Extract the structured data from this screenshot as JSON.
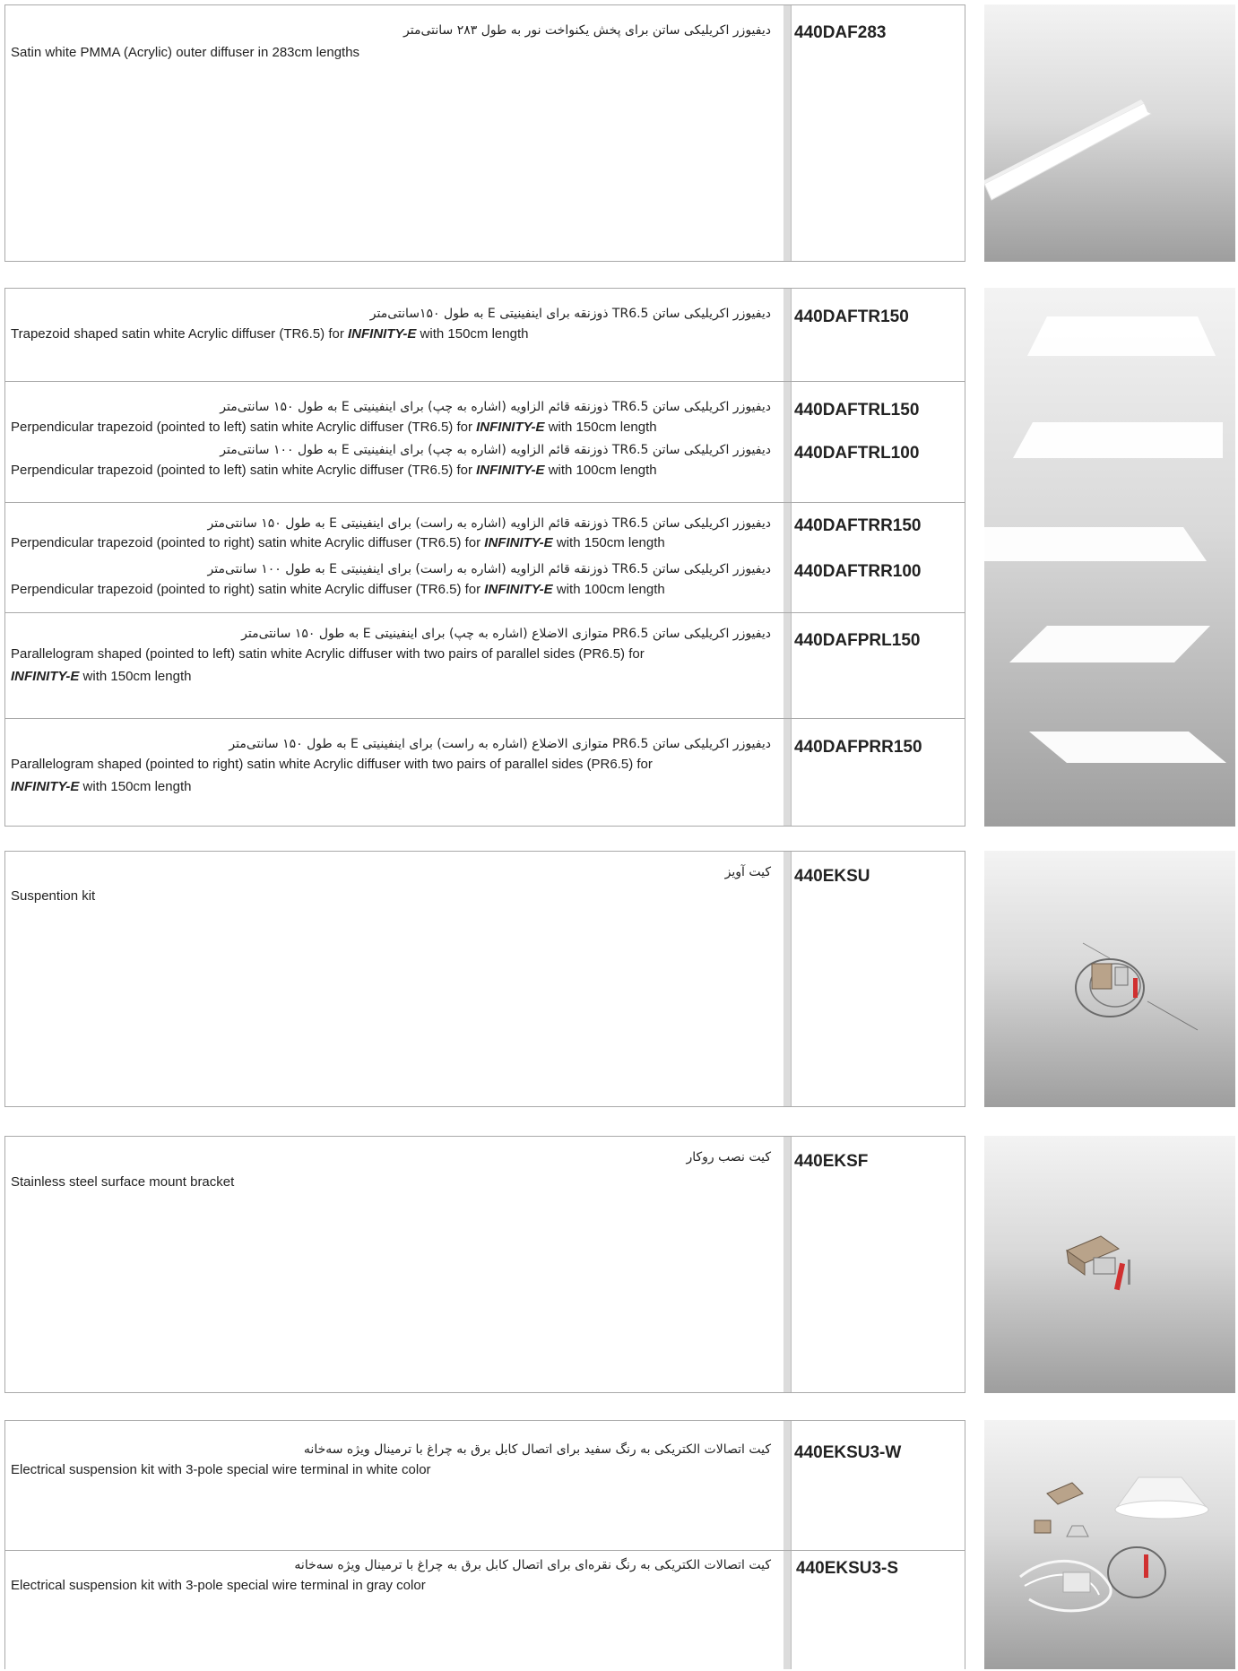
{
  "sections": [
    {
      "rows": [
        {
          "code": "440DAF283",
          "fa": "دیفیوزر اکریلیکی ساتن برای پخش یکنواخت نور به طول ۲۸۳ سانتی‌متر",
          "en": "Satin white PMMA (Acrylic) outer diffuser in 283cm lengths"
        }
      ],
      "image": "straight-diffuser-profile"
    },
    {
      "rows": [
        {
          "code": "440DAFTR150",
          "fa": "دیفیوزر اکریلیکی ساتن TR6.5 ذوزنقه برای اینفینیتی E به طول ۱۵۰سانتی‌متر",
          "en_pre": "Trapezoid shaped satin white Acrylic diffuser (TR6.5) for ",
          "en_brand": "INFINITY-E",
          "en_post": " with 150cm length"
        },
        {
          "code": "440DAFTRL150",
          "fa": "دیفیوزر اکریلیکی ساتن TR6.5 ذوزنقه قائم الزاویه (اشاره به چپ) برای اینفینیتی E به طول ۱۵۰ سانتی‌متر",
          "en_pre": "Perpendicular trapezoid (pointed to left) satin white Acrylic diffuser (TR6.5) for ",
          "en_brand": "INFINITY-E",
          "en_post": " with 150cm length"
        },
        {
          "code": "440DAFTRL100",
          "fa": "دیفیوزر اکریلیکی ساتن TR6.5 ذوزنقه قائم الزاویه (اشاره به چپ) برای اینفینیتی E به طول ۱۰۰ سانتی‌متر",
          "en_pre": "Perpendicular trapezoid (pointed to left) satin white Acrylic diffuser (TR6.5) for ",
          "en_brand": "INFINITY-E",
          "en_post": " with 100cm length"
        },
        {
          "code": "440DAFTRR150",
          "fa": "دیفیوزر اکریلیکی ساتن TR6.5 ذوزنقه قائم الزاویه (اشاره به راست) برای اینفینیتی E به طول ۱۵۰ سانتی‌متر",
          "en_pre": "Perpendicular trapezoid (pointed to right) satin white Acrylic diffuser (TR6.5) for ",
          "en_brand": "INFINITY-E",
          "en_post": " with 150cm length"
        },
        {
          "code": "440DAFTRR100",
          "fa": "دیفیوزر اکریلیکی ساتن TR6.5 ذوزنقه قائم الزاویه (اشاره به راست) برای اینفینیتی E به طول ۱۰۰ سانتی‌متر",
          "en_pre": "Perpendicular trapezoid (pointed to right) satin white Acrylic diffuser (TR6.5) for ",
          "en_brand": "INFINITY-E",
          "en_post": " with 100cm length"
        },
        {
          "code": "440DAFPRL150",
          "fa": "دیفیوزر اکریلیکی ساتن PR6.5 متوازی الاضلاع (اشاره به چپ) برای اینفینیتی E به طول ۱۵۰ سانتی‌متر",
          "en_pre": "Parallelogram shaped (pointed to left) satin white Acrylic diffuser with two pairs of parallel sides (PR6.5) for",
          "en_brand": "INFINITY-E",
          "en_post": " with 150cm length"
        },
        {
          "code": "440DAFPRR150",
          "fa": "دیفیوزر اکریلیکی ساتن PR6.5 متوازی الاضلاع (اشاره به راست) برای اینفینیتی E به طول ۱۵۰ سانتی‌متر",
          "en_pre": "Parallelogram shaped (pointed to right) satin white Acrylic diffuser with two pairs of parallel sides (PR6.5) for",
          "en_brand": "INFINITY-E",
          "en_post": " with 150cm length"
        }
      ],
      "image": "trapezoid-and-parallelogram-diffusers"
    },
    {
      "rows": [
        {
          "code": "440EKSU",
          "fa": "کیت آویز",
          "en": "Suspention kit"
        }
      ],
      "image": "suspension-kit"
    },
    {
      "rows": [
        {
          "code": "440EKSF",
          "fa": "کیت نصب روکار",
          "en": "Stainless steel surface mount bracket"
        }
      ],
      "image": "surface-mount-bracket"
    },
    {
      "rows": [
        {
          "code": "440EKSU3-W",
          "fa": "کیت اتصالات الکتریکی به رنگ سفید برای اتصال کابل برق به چراغ با ترمینال ویژه سه‌خانه",
          "en": "Electrical suspension kit with 3-pole special wire terminal in white color"
        },
        {
          "code": "440EKSU3-S",
          "fa": "کیت اتصالات الکتریکی به رنگ نقره‌ای برای اتصال کابل برق به چراغ با ترمینال ویژه سه‌خانه",
          "en": "Electrical suspension kit with 3-pole special wire terminal in gray color"
        }
      ],
      "image": "electrical-suspension-kit"
    }
  ]
}
